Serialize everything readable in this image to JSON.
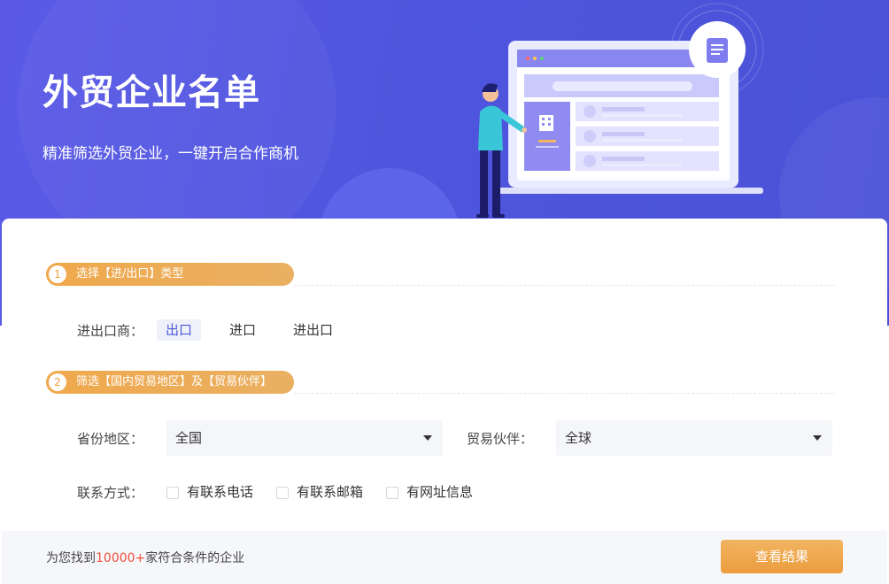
{
  "hero": {
    "title": "外贸企业名单",
    "subtitle": "精准筛选外贸企业，一键开启合作商机"
  },
  "step1": {
    "number": "1",
    "label": "选择【进/出口】类型",
    "row_label": "进出口商：",
    "options": [
      "出口",
      "进口",
      "进出口"
    ],
    "selected": "出口"
  },
  "step2": {
    "number": "2",
    "label": "筛选【国内贸易地区】及【贸易伙伴】",
    "province_label": "省份地区：",
    "province_value": "全国",
    "partner_label": "贸易伙伴：",
    "partner_value": "全球",
    "contact_label": "联系方式：",
    "contact_options": [
      "有联系电话",
      "有联系邮箱",
      "有网址信息"
    ]
  },
  "footer": {
    "prefix": "为您找到",
    "count": "10000+",
    "suffix": "家符合条件的企业",
    "button": "查看结果"
  },
  "colors": {
    "hero_bg": "#4f55de",
    "accent": "#4e5bd6",
    "orange": "#f0a84c",
    "count_red": "#f0503a"
  },
  "icons": [
    "document-icon",
    "building-icon",
    "chevron-down-icon",
    "checkbox-icon"
  ]
}
